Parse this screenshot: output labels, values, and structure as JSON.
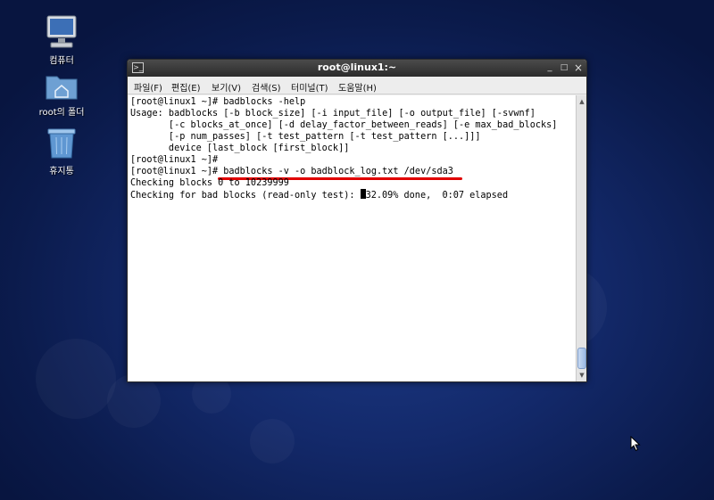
{
  "desktop": {
    "icons": [
      {
        "label": "컴퓨터",
        "icon": "computer-icon"
      },
      {
        "label": "root의 폴더",
        "icon": "home-folder-icon"
      },
      {
        "label": "휴지통",
        "icon": "trash-icon"
      }
    ]
  },
  "window": {
    "title": "root@linux1:~",
    "controls": {
      "minimize": "_",
      "maximize": "□",
      "close": "×"
    },
    "menu": [
      "파일(F)",
      "편집(E)",
      "보기(V)",
      "검색(S)",
      "터미널(T)",
      "도움말(H)"
    ]
  },
  "terminal": {
    "lines": [
      "[root@linux1 ~]# badblocks -help",
      "Usage: badblocks [-b block_size] [-i input_file] [-o output_file] [-svwnf]",
      "       [-c blocks_at_once] [-d delay_factor_between_reads] [-e max_bad_blocks]",
      "       [-p num_passes] [-t test_pattern [-t test_pattern [...]]]",
      "       device [last_block [first_block]]",
      "[root@linux1 ~]#",
      "[root@linux1 ~]# badblocks -v -o badblock_log.txt /dev/sda3",
      "Checking blocks 0 to 10239999"
    ],
    "progress_prefix": "Checking for bad blocks (read-only test): ",
    "progress_suffix": "32.09% done,  0:07 elapsed",
    "progress_percent": 32.09
  },
  "colors": {
    "highlight_underline": "#e00000"
  }
}
